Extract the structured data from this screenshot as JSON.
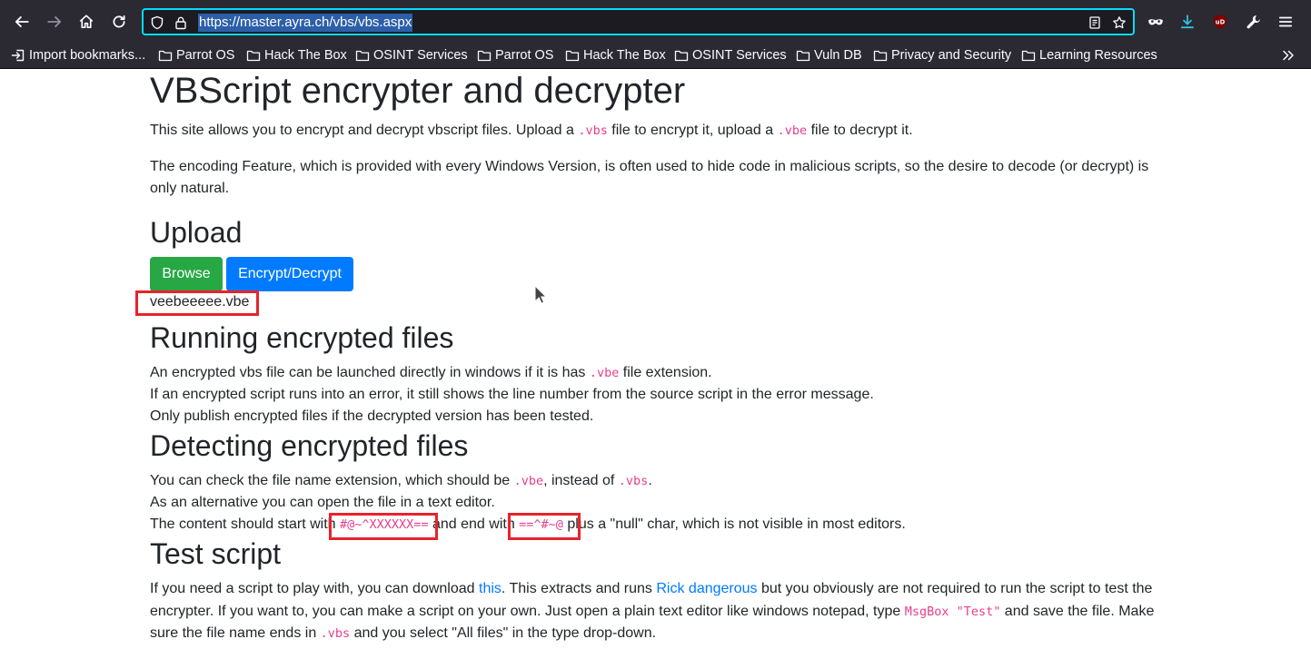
{
  "browser": {
    "url": "https://master.ayra.ch/vbs/vbs.aspx",
    "bookmarks": [
      {
        "label": "Import bookmarks..."
      },
      {
        "label": "Parrot OS"
      },
      {
        "label": "Hack The Box"
      },
      {
        "label": "OSINT Services"
      },
      {
        "label": "Parrot OS"
      },
      {
        "label": "Hack The Box"
      },
      {
        "label": "OSINT Services"
      },
      {
        "label": "Vuln DB"
      },
      {
        "label": "Privacy and Security"
      },
      {
        "label": "Learning Resources"
      }
    ],
    "accent_color": "#00ddff"
  },
  "page": {
    "title": "VBScript encrypter and decrypter",
    "intro": {
      "p1_a": "This site allows you to encrypt and decrypt vbscript files. Upload a ",
      "p1_code1": ".vbs",
      "p1_b": " file to encrypt it, upload a ",
      "p1_code2": ".vbe",
      "p1_c": " file to decrypt it.",
      "p2_line1": "The encoding Feature, which is provided with every Windows Version, is often used to hide code in malicious scripts, so the desire to decode (or decrypt) is",
      "p2_line2": "only natural."
    },
    "upload": {
      "heading": "Upload",
      "browse_label": "Browse",
      "encrypt_label": "Encrypt/Decrypt",
      "selected_file": "veebeeeee.vbe"
    },
    "running": {
      "heading": "Running encrypted files",
      "l1_a": "An encrypted vbs file can be launched directly in windows if it is has ",
      "l1_code": ".vbe",
      "l1_b": " file extension.",
      "l2": "If an encrypted script runs into an error, it still shows the line number from the source script in the error message.",
      "l3": "Only publish encrypted files if the decrypted version has been tested."
    },
    "detecting": {
      "heading": "Detecting encrypted files",
      "l1_a": "You can check the file name extension, which should be ",
      "l1_code1": ".vbe",
      "l1_b": ", instead of ",
      "l1_code2": ".vbs",
      "l1_c": ".",
      "l2": "As an alternative you can open the file in a text editor.",
      "l3_a": "The content should start with ",
      "l3_code1": "#@~^XXXXXX==",
      "l3_b": " and end with ",
      "l3_code2": "==^#~@",
      "l3_c": " plus a \"null\" char, which is not visible in most editors."
    },
    "test": {
      "heading": "Test script",
      "l1_a": "If you need a script to play with, you can download ",
      "l1_link1": "this",
      "l1_b": ". This extracts and runs ",
      "l1_link2": "Rick dangerous",
      "l1_c": " but you obviously are not required to run the script to test the",
      "l2_a": "encrypter. If you want to, you can make a script on your own. Just open a plain text editor like windows notepad, type ",
      "l2_code": "MsgBox \"Test\"",
      "l2_b": " and save the file. Make",
      "l3_a": "sure the file name ends in ",
      "l3_code": ".vbs",
      "l3_b": " and you select \"All files\" in the type drop-down."
    }
  }
}
